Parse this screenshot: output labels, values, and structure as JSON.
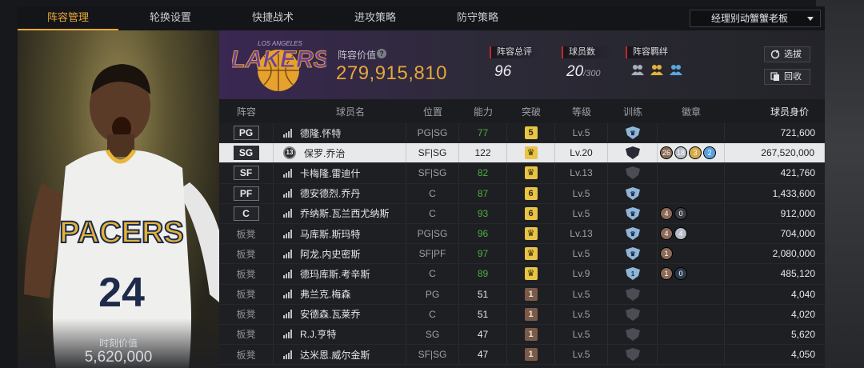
{
  "tabs": [
    "阵容管理",
    "轮换设置",
    "快捷战术",
    "进攻策略",
    "防守策略"
  ],
  "team_select": "经理别动蟹蟹老板",
  "portrait": {
    "caption_label": "时刻价值",
    "caption_value": "5,620,000",
    "jersey_text": "PACERS",
    "jersey_number": "24"
  },
  "header": {
    "logo_text": "LAKERS",
    "logo_small": "LOS ANGELES",
    "lineup_value_label": "阵容价值",
    "lineup_value": "279,915,810",
    "rating_label": "阵容总评",
    "rating_value": "96",
    "players_label": "球员数",
    "players_value": "20",
    "players_total": "/300",
    "bond_label": "阵容羁绊",
    "select_button": "选拔",
    "recall_button": "回收"
  },
  "columns": [
    "阵容",
    "球员名",
    "位置",
    "能力",
    "突破",
    "等级",
    "训练",
    "徽章",
    "球员身价"
  ],
  "rows": [
    {
      "slot": "PG",
      "starter": true,
      "name": "德隆.怀特",
      "role": "PG|SG",
      "ability": "77",
      "ability_color": "green",
      "breakthrough": "5",
      "brk_type": "gold",
      "level": "Lv.5",
      "training": "",
      "badges": [],
      "salary": "721,600",
      "selected": false
    },
    {
      "slot": "SG",
      "starter": true,
      "name": "保罗.乔治",
      "role": "SF|SG",
      "ability": "122",
      "ability_color": "white",
      "breakthrough": "crown",
      "brk_type": "gold",
      "level": "Lv.20",
      "training": "crown",
      "badges": [
        "26",
        "18",
        "3",
        "2"
      ],
      "salary": "267,520,000",
      "selected": true,
      "level_badge": "13"
    },
    {
      "slot": "SF",
      "starter": true,
      "name": "卡梅隆.雷迪什",
      "role": "SF|SG",
      "ability": "82",
      "ability_color": "green",
      "breakthrough": "crown",
      "brk_type": "gold",
      "level": "Lv.13",
      "training": "",
      "badges": [],
      "salary": "421,760",
      "selected": false
    },
    {
      "slot": "PF",
      "starter": true,
      "name": "德安德烈.乔丹",
      "role": "C",
      "ability": "87",
      "ability_color": "green",
      "breakthrough": "6",
      "brk_type": "gold",
      "level": "Lv.5",
      "training": "",
      "badges": [],
      "salary": "1,433,600",
      "selected": false
    },
    {
      "slot": "C",
      "starter": true,
      "name": "乔纳斯.瓦兰西尤纳斯",
      "role": "C",
      "ability": "93",
      "ability_color": "green",
      "breakthrough": "6",
      "brk_type": "gold",
      "level": "Lv.5",
      "training": "",
      "badges": [
        "4",
        "0"
      ],
      "salary": "912,000",
      "selected": false
    },
    {
      "slot": "板凳",
      "starter": false,
      "name": "马库斯.斯玛特",
      "role": "PG|SG",
      "ability": "96",
      "ability_color": "green",
      "breakthrough": "crown",
      "brk_type": "gold",
      "level": "Lv.13",
      "training": "",
      "badges": [
        "4",
        "4"
      ],
      "salary": "704,000",
      "selected": false
    },
    {
      "slot": "板凳",
      "starter": false,
      "name": "阿龙.内史密斯",
      "role": "SF|PF",
      "ability": "97",
      "ability_color": "green",
      "breakthrough": "crown",
      "brk_type": "gold",
      "level": "Lv.5",
      "training": "",
      "badges": [
        "1"
      ],
      "salary": "2,080,000",
      "selected": false
    },
    {
      "slot": "板凳",
      "starter": false,
      "name": "德玛库斯.考辛斯",
      "role": "C",
      "ability": "89",
      "ability_color": "green",
      "breakthrough": "crown",
      "brk_type": "gold",
      "level": "Lv.9",
      "training": "1",
      "badges": [
        "1",
        "0"
      ],
      "salary": "485,120",
      "selected": false
    },
    {
      "slot": "板凳",
      "starter": false,
      "name": "弗兰克.梅森",
      "role": "PG",
      "ability": "51",
      "ability_color": "white",
      "breakthrough": "1",
      "brk_type": "bronze",
      "level": "Lv.5",
      "training": "",
      "badges": [],
      "salary": "4,040",
      "selected": false
    },
    {
      "slot": "板凳",
      "starter": false,
      "name": "安德森.瓦莱乔",
      "role": "C",
      "ability": "51",
      "ability_color": "white",
      "breakthrough": "1",
      "brk_type": "bronze",
      "level": "Lv.5",
      "training": "",
      "badges": [],
      "salary": "4,020",
      "selected": false
    },
    {
      "slot": "板凳",
      "starter": false,
      "name": "R.J.亨特",
      "role": "SG",
      "ability": "47",
      "ability_color": "white",
      "breakthrough": "1",
      "brk_type": "bronze",
      "level": "Lv.5",
      "training": "",
      "badges": [],
      "salary": "5,620",
      "selected": false
    },
    {
      "slot": "板凳",
      "starter": false,
      "name": "达米恩.威尔金斯",
      "role": "SF|SG",
      "ability": "47",
      "ability_color": "white",
      "breakthrough": "1",
      "brk_type": "bronze",
      "level": "Lv.5",
      "training": "",
      "badges": [],
      "salary": "4,050",
      "selected": false
    }
  ]
}
